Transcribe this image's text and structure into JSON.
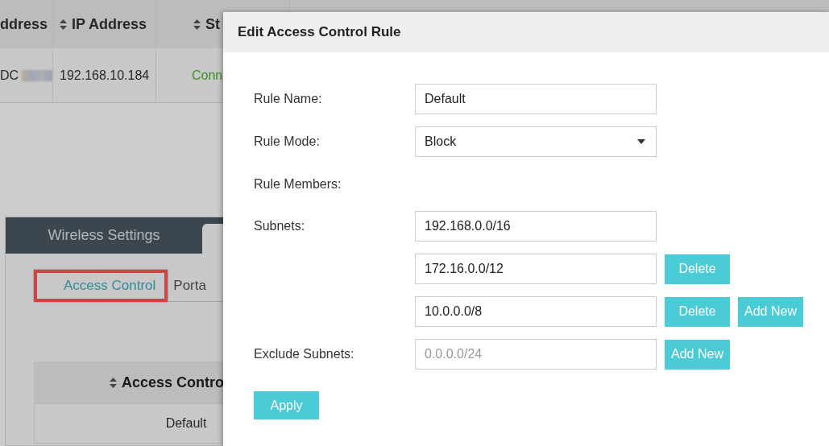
{
  "background": {
    "clients_table": {
      "columns": [
        {
          "label": "ddress"
        },
        {
          "label": "IP Address",
          "sortable": true
        },
        {
          "label": "St",
          "sortable": true
        }
      ],
      "rows": [
        {
          "cells": [
            {
              "text": "DC",
              "blurred": true
            },
            {
              "text": "192.168.10.184"
            },
            {
              "text": "Conn",
              "kind": "status"
            }
          ]
        }
      ]
    },
    "tabs": [
      {
        "label": "Wireless Settings",
        "selected": false
      }
    ],
    "subtabs": [
      {
        "label": "Access Control",
        "selected": true
      },
      {
        "label": "Porta",
        "selected": false
      }
    ],
    "rule_table": {
      "columns": [
        {
          "label": "Access Contro",
          "sortable": true
        }
      ],
      "rows": [
        {
          "cells": [
            "Default"
          ]
        }
      ]
    }
  },
  "dialog": {
    "title": "Edit Access Control Rule",
    "fields": [
      {
        "kind": "text",
        "label": "Rule Name:",
        "value": "Default"
      },
      {
        "kind": "select",
        "label": "Rule Mode:",
        "value": "Block"
      },
      {
        "kind": "heading",
        "label": "Rule Members:"
      },
      {
        "kind": "list",
        "label": "Subnets:",
        "entries": [
          {
            "value": "192.168.0.0/16"
          },
          {
            "value": "172.16.0.0/12",
            "buttons": [
              "Delete"
            ]
          },
          {
            "value": "10.0.0.0/8",
            "buttons": [
              "Delete",
              "Add New"
            ]
          }
        ]
      },
      {
        "kind": "list",
        "label": "Exclude Subnets:",
        "entries": [
          {
            "placeholder": "0.0.0.0/24",
            "buttons": [
              "Add New"
            ]
          }
        ]
      }
    ],
    "apply_button": "Apply"
  }
}
